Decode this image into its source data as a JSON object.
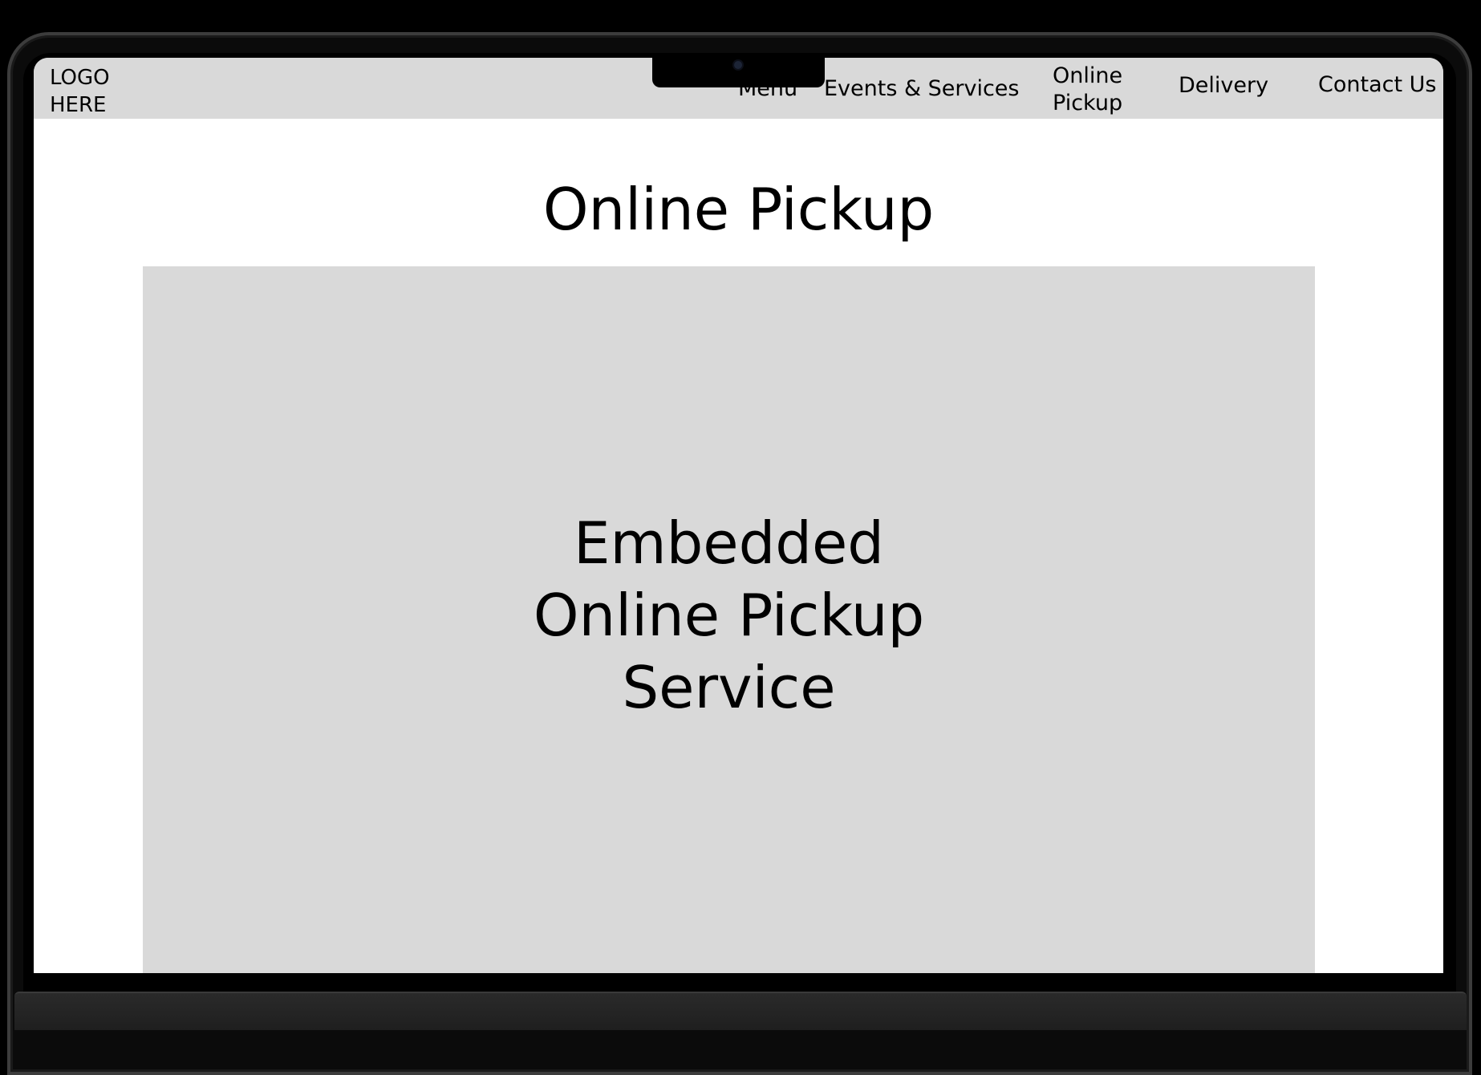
{
  "header": {
    "logo_text": "LOGO\nHERE",
    "nav": {
      "menu": "Menu",
      "events": "Events & Services",
      "pickup": "Online\nPickup",
      "delivery": "Delivery",
      "contact": "Contact Us"
    }
  },
  "main": {
    "title": "Online Pickup",
    "embed_placeholder": "Embedded\nOnline Pickup\nService"
  },
  "colors": {
    "navbar_bg": "#d9d9d9",
    "page_bg": "#ffffff",
    "placeholder_bg": "#d9d9d9",
    "device_frame": "#000000"
  }
}
